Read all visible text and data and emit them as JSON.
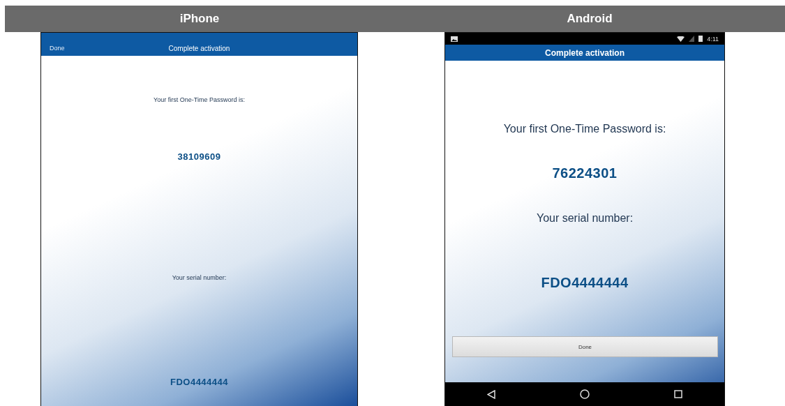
{
  "columns": [
    {
      "kind": "ios",
      "platform_label": "iPhone",
      "nav_button": "Done",
      "title": "Complete activation",
      "otp_label": "Your first One-Time Password is:",
      "otp": "38109609",
      "serial_label": "Your serial number:",
      "serial": "FDO4444444"
    },
    {
      "kind": "android",
      "platform_label": "Android",
      "status_time": "4:11",
      "title": "Complete activation",
      "otp_label": "Your first One-Time Password is:",
      "otp": "76224301",
      "serial_label": "Your serial number:",
      "serial": "FDO4444444",
      "button": "Done"
    }
  ]
}
